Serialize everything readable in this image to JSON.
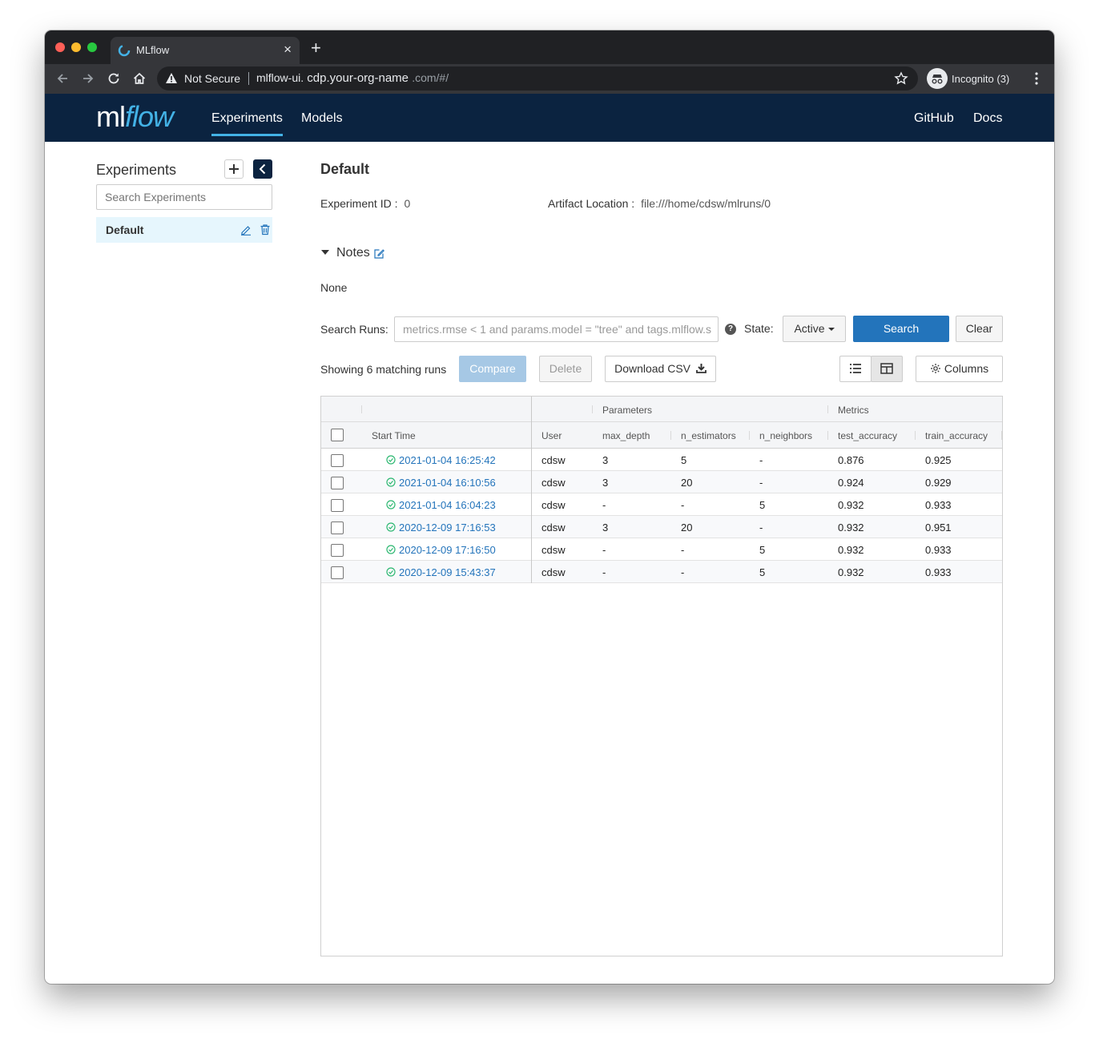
{
  "browser": {
    "tab_title": "MLflow",
    "tab_close": "×",
    "new_tab": "+",
    "security_label": "Not Secure",
    "url_host": "mlflow-ui.",
    "url_org": " cdp.your-org-name ",
    "url_rest": ".com/#/",
    "incognito_label": "Incognito (3)"
  },
  "header": {
    "logo_ml": "ml",
    "logo_flow": "flow",
    "nav": [
      {
        "label": "Experiments",
        "active": true
      },
      {
        "label": "Models",
        "active": false
      }
    ],
    "right_links": [
      "GitHub",
      "Docs"
    ]
  },
  "sidebar": {
    "title": "Experiments",
    "add_button": "+",
    "search_placeholder": "Search Experiments",
    "items": [
      {
        "name": "Default",
        "selected": true
      }
    ]
  },
  "experiment": {
    "name": "Default",
    "id_label": "Experiment ID :",
    "id_value": "0",
    "artifact_label": "Artifact Location :",
    "artifact_value": "file:///home/cdsw/mlruns/0",
    "notes_label": "Notes",
    "notes_value": "None"
  },
  "search": {
    "label": "Search Runs:",
    "placeholder": "metrics.rmse < 1 and params.model = \"tree\" and tags.mlflow.s",
    "help": "?",
    "state_label": "State:",
    "state_value": "Active",
    "search_button": "Search",
    "clear_button": "Clear"
  },
  "runs_toolbar": {
    "showing": "Showing 6 matching runs",
    "compare": "Compare",
    "delete": "Delete",
    "download": "Download CSV",
    "columns": "Columns"
  },
  "table": {
    "groups": {
      "parameters": "Parameters",
      "metrics": "Metrics"
    },
    "columns": [
      "Start Time",
      "User",
      "max_depth",
      "n_estimators",
      "n_neighbors",
      "test_accuracy",
      "train_accuracy"
    ],
    "rows": [
      {
        "start_time": "2021-01-04 16:25:42",
        "user": "cdsw",
        "max_depth": "3",
        "n_estimators": "5",
        "n_neighbors": "-",
        "test_accuracy": "0.876",
        "train_accuracy": "0.925"
      },
      {
        "start_time": "2021-01-04 16:10:56",
        "user": "cdsw",
        "max_depth": "3",
        "n_estimators": "20",
        "n_neighbors": "-",
        "test_accuracy": "0.924",
        "train_accuracy": "0.929"
      },
      {
        "start_time": "2021-01-04 16:04:23",
        "user": "cdsw",
        "max_depth": "-",
        "n_estimators": "-",
        "n_neighbors": "5",
        "test_accuracy": "0.932",
        "train_accuracy": "0.933"
      },
      {
        "start_time": "2020-12-09 17:16:53",
        "user": "cdsw",
        "max_depth": "3",
        "n_estimators": "20",
        "n_neighbors": "-",
        "test_accuracy": "0.932",
        "train_accuracy": "0.951"
      },
      {
        "start_time": "2020-12-09 17:16:50",
        "user": "cdsw",
        "max_depth": "-",
        "n_estimators": "-",
        "n_neighbors": "5",
        "test_accuracy": "0.932",
        "train_accuracy": "0.933"
      },
      {
        "start_time": "2020-12-09 15:43:37",
        "user": "cdsw",
        "max_depth": "-",
        "n_estimators": "-",
        "n_neighbors": "5",
        "test_accuracy": "0.932",
        "train_accuracy": "0.933"
      }
    ]
  },
  "colors": {
    "header_bg": "#0b2340",
    "accent": "#43b2e6",
    "primary": "#2374bb",
    "success": "#2eb872"
  }
}
